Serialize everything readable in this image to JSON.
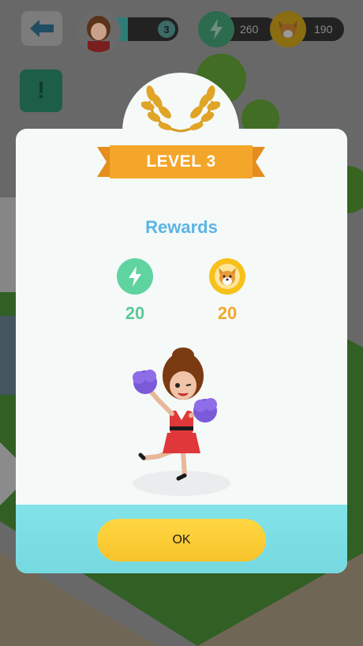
{
  "hud": {
    "player_level": "3",
    "energy_value": "260",
    "coin_value": "190"
  },
  "dialog": {
    "level_label": "LEVEL 3",
    "rewards_title": "Rewards",
    "rewards": [
      {
        "type": "energy",
        "icon": "lightning-icon",
        "amount": "20",
        "color": "#5fd3a0"
      },
      {
        "type": "coin",
        "icon": "corgi-coin-icon",
        "amount": "20",
        "color": "#f7c11a"
      }
    ],
    "ok_label": "OK"
  },
  "colors": {
    "ribbon": "#f4a62a",
    "footer": "#7fdfe5",
    "button": "#fbcd35",
    "rewards_title": "#5bb4e6"
  }
}
